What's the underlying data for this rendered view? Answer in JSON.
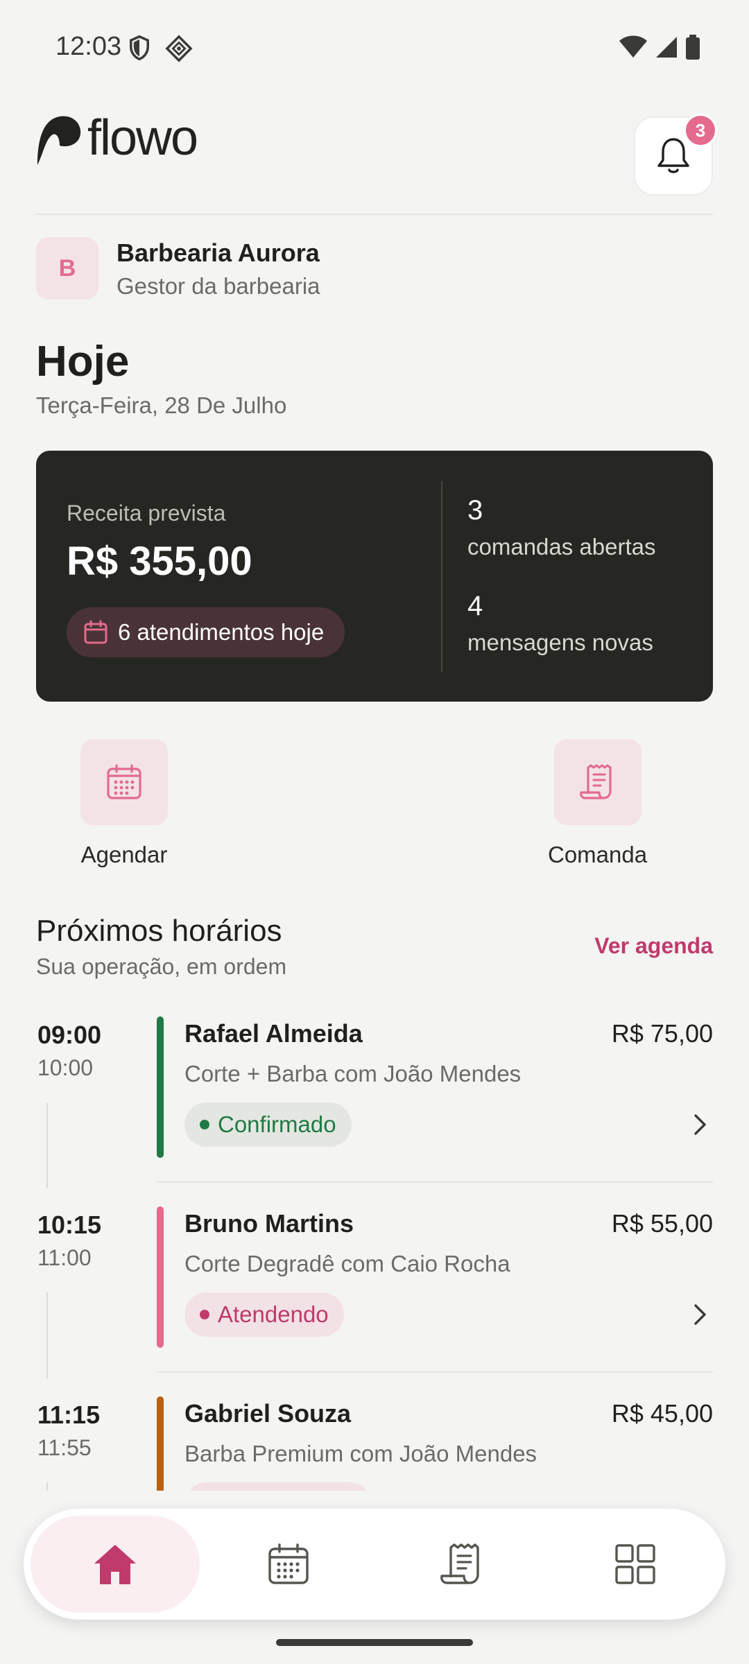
{
  "status_bar": {
    "time": "12:03"
  },
  "header": {
    "logo_text": "flowo",
    "notification_count": "3"
  },
  "business": {
    "initial": "B",
    "name": "Barbearia Aurora",
    "role": "Gestor da barbearia"
  },
  "today": {
    "title": "Hoje",
    "date": "Terça-Feira, 28 De Julho"
  },
  "summary": {
    "revenue_label": "Receita prevista",
    "revenue_value": "R$ 355,00",
    "appointments_pill": "6 atendimentos hoje",
    "open_orders_count": "3",
    "open_orders_label": "comandas abertas",
    "new_messages_count": "4",
    "new_messages_label": "mensagens novas"
  },
  "actions": {
    "schedule_label": "Agendar",
    "order_label": "Comanda"
  },
  "upcoming": {
    "title": "Próximos horários",
    "subtitle": "Sua operação, em ordem",
    "link": "Ver agenda",
    "appointments": [
      {
        "start": "09:00",
        "end": "10:00",
        "name": "Rafael Almeida",
        "price": "R$ 75,00",
        "service": "Corte + Barba com João Mendes",
        "status": "Confirmado",
        "color": "#1f7a45"
      },
      {
        "start": "10:15",
        "end": "11:00",
        "name": "Bruno Martins",
        "price": "R$ 55,00",
        "service": "Corte Degradê com Caio Rocha",
        "status": "Atendendo",
        "color": "#e46a8e"
      },
      {
        "start": "11:15",
        "end": "11:55",
        "name": "Gabriel Souza",
        "price": "R$ 45,00",
        "service": "Barba Premium com João Mendes",
        "status": "",
        "color": "#b8620f"
      }
    ]
  },
  "nav": {
    "items": [
      "home-icon",
      "calendar-icon",
      "receipt-icon",
      "grid-icon"
    ],
    "active": "home-icon",
    "accent": "#c03a6c"
  }
}
